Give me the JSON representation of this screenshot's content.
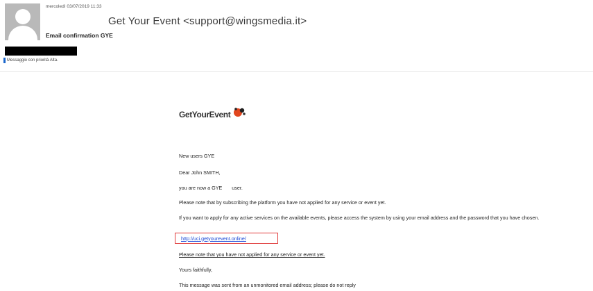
{
  "header": {
    "date": "mercoledì 03/07/2019 11:33",
    "sender": "Get Your Event <support@wingsmedia.it>",
    "subject": "Email confirmation GYE",
    "priority": "Messaggio con priorità Alta."
  },
  "email": {
    "logo_text": "GetYourEvent",
    "line1": "New users GYE",
    "line2": "Dear John SMITH,",
    "line3": "you are now a GYE       user.",
    "line4": "Please note that by subscribing the platform you have not applied for any service or event yet.",
    "line5": "If you want to apply for any active services on the available events, please access the system by using your email address and the password that you have chosen.",
    "link": "http://uci.getyourevent.online/",
    "line7": "Please note that you have not applied for any service or event yet.",
    "line8": "Yours faithfully,",
    "line9": "This message was sent from an unmonitored email address; please do not reply"
  }
}
